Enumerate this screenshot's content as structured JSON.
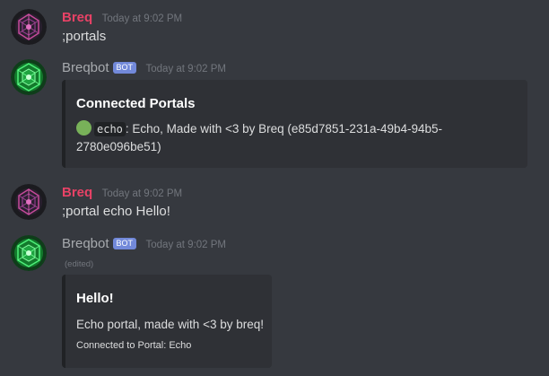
{
  "messages": [
    {
      "author": "Breq",
      "timestamp": "Today at 9:02 PM",
      "text": ";portals"
    },
    {
      "author": "Breqbot",
      "badge": "BOT",
      "timestamp": "Today at 9:02 PM",
      "embed": {
        "title": "Connected Portals",
        "portal_name": "echo",
        "line1_rest": ": Echo, Made with <3 by Breq (e85d7851-231a-49b4-94b5-",
        "line2": "2780e096be51)"
      }
    },
    {
      "author": "Breq",
      "timestamp": "Today at 9:02 PM",
      "text": ";portal echo Hello!"
    },
    {
      "author": "Breqbot",
      "badge": "BOT",
      "timestamp": "Today at 9:02 PM",
      "edited": "(edited)",
      "embed": {
        "title": "Hello!",
        "description": "Echo portal, made with <3 by breq!",
        "footer": "Connected to Portal: Echo"
      }
    }
  ],
  "colors": {
    "background": "#36393f",
    "user_name": "#e84266",
    "bot_badge": "#7289da",
    "embed_bg": "#2f3136",
    "green_circle": "#78b159"
  },
  "icons": {
    "user_avatar": "purple-geometric-avatar-icon",
    "bot_avatar": "green-geometric-avatar-icon",
    "status": "green-circle-icon"
  }
}
